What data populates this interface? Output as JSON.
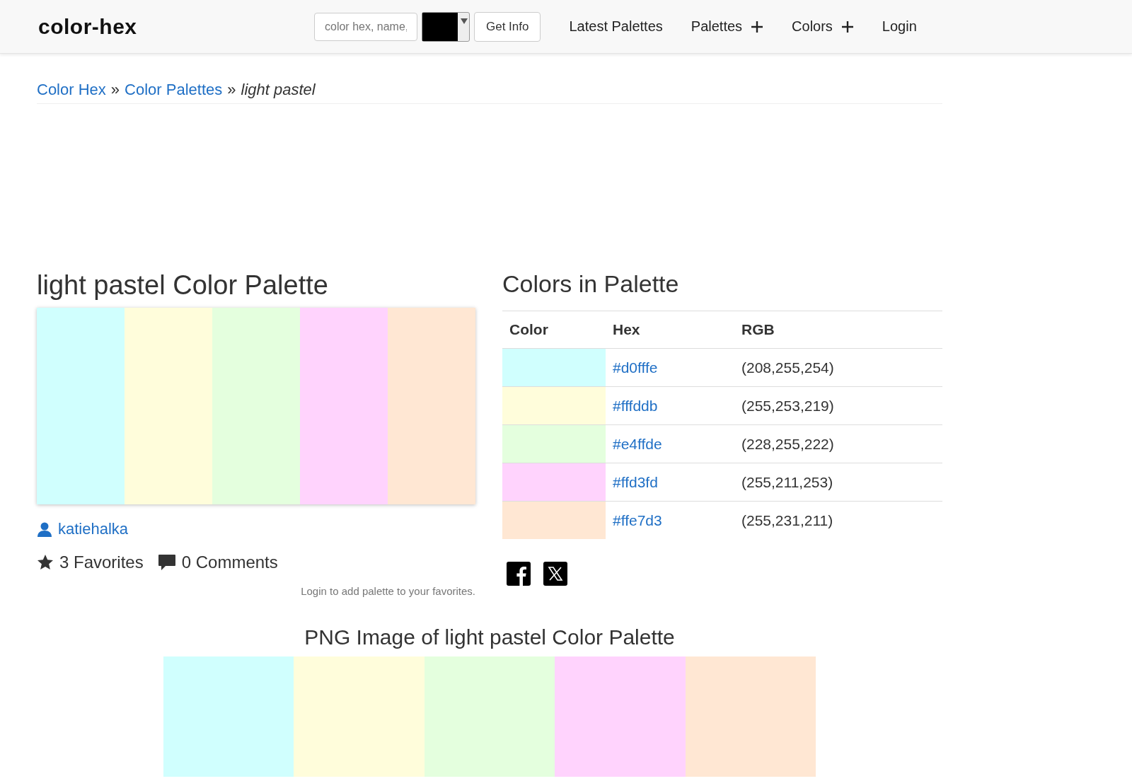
{
  "header": {
    "logo": "color-hex",
    "search": {
      "placeholder": "color hex, name,"
    },
    "button": "Get Info",
    "nav": [
      {
        "label": "Latest Palettes",
        "kind": "link"
      },
      {
        "label": "Palettes",
        "kind": "menu"
      },
      {
        "label": "Colors",
        "kind": "menu"
      },
      {
        "label": "Login",
        "kind": "link"
      }
    ]
  },
  "breadcrumb": {
    "links": [
      "Color Hex",
      "Color Palettes"
    ],
    "separator": "»",
    "current": "light pastel"
  },
  "palette": {
    "title": "light pastel Color Palette",
    "swatches": [
      {
        "color": "#d0fffe"
      },
      {
        "color": "#fffddb"
      },
      {
        "color": "#e4ffde"
      },
      {
        "color": "#ffd3fd"
      },
      {
        "color": "#ffe7d3"
      }
    ],
    "author": "katiehalka",
    "favorites": "3 Favorites",
    "comments": "0 Comments",
    "login_note": "Login to add palette to your favorites."
  },
  "colors_table": {
    "title": "Colors in Palette",
    "columns": [
      "Color",
      "Hex",
      "RGB"
    ],
    "rows": [
      {
        "color": "#d0fffe",
        "hex": "#d0fffe",
        "rgb": "(208,255,254)"
      },
      {
        "color": "#fffddb",
        "hex": "#fffddb",
        "rgb": "(255,253,219)"
      },
      {
        "color": "#e4ffde",
        "hex": "#e4ffde",
        "rgb": "(228,255,222)"
      },
      {
        "color": "#ffd3fd",
        "hex": "#ffd3fd",
        "rgb": "(255,211,253)"
      },
      {
        "color": "#ffe7d3",
        "hex": "#ffe7d3",
        "rgb": "(255,231,211)"
      }
    ]
  },
  "png_image": {
    "title": "PNG Image of light pastel Color Palette",
    "swatches": [
      {
        "color": "#d0fffe"
      },
      {
        "color": "#fffddb"
      },
      {
        "color": "#e4ffde"
      },
      {
        "color": "#ffd3fd"
      },
      {
        "color": "#ffe7d3"
      }
    ]
  }
}
